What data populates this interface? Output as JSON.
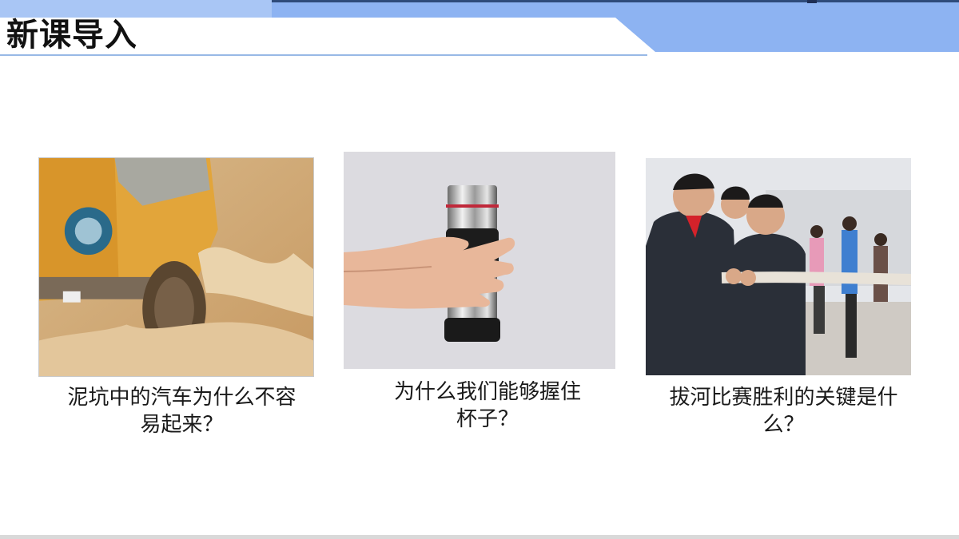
{
  "slide": {
    "title": "新课导入",
    "colors": {
      "header_band": "#8db3f2",
      "header_dark_line": "#2e4b7a",
      "underline": "#5b8fd6"
    }
  },
  "cards": [
    {
      "image_alt": "car-stuck-in-mud-image",
      "caption_line1": "泥坑中的汽车为什么不容",
      "caption_line2": "易起来？"
    },
    {
      "image_alt": "hand-holding-cup-image",
      "caption_line1": "为什么我们能够握住",
      "caption_line2": "杯子？"
    },
    {
      "image_alt": "tug-of-war-image",
      "caption_line1": "拔河比赛胜利的关键是什",
      "caption_line2": "么？"
    }
  ]
}
